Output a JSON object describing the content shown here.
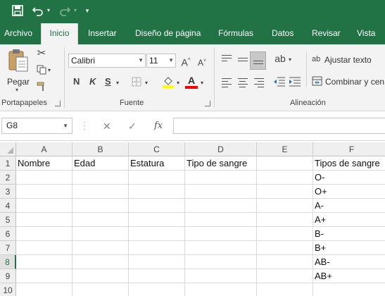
{
  "qat": {
    "save_icon": "save-icon",
    "undo_icon": "undo-icon",
    "redo_icon": "redo-icon",
    "customize_icon": "customize-qat-icon"
  },
  "tabs": [
    "Archivo",
    "Inicio",
    "Insertar",
    "Diseño de página",
    "Fórmulas",
    "Datos",
    "Revisar",
    "Vista"
  ],
  "active_tab": "Inicio",
  "ribbon": {
    "clipboard": {
      "paste_label": "Pegar",
      "group_label": "Portapapeles"
    },
    "font": {
      "font_name": "Calibri",
      "font_size": "11",
      "bold": "N",
      "italic": "K",
      "underline": "S",
      "group_label": "Fuente",
      "highlight_color": "#ffff00",
      "font_color": "#ff0000"
    },
    "alignment": {
      "wrap_label": "Ajustar texto",
      "merge_label": "Combinar y cen",
      "group_label": "Alineación"
    }
  },
  "formula_bar": {
    "name_box": "G8",
    "fx": "fx",
    "formula": ""
  },
  "sheet": {
    "columns": [
      "A",
      "B",
      "C",
      "D",
      "E",
      "F"
    ],
    "rows": [
      "1",
      "2",
      "3",
      "4",
      "5",
      "6",
      "7",
      "8",
      "9",
      "10"
    ],
    "selected_row": "8",
    "cells": [
      [
        "Nombre",
        "Edad",
        "Estatura",
        "Tipo de sangre",
        "",
        "Tipos de sangre"
      ],
      [
        "",
        "",
        "",
        "",
        "",
        "O-"
      ],
      [
        "",
        "",
        "",
        "",
        "",
        "O+"
      ],
      [
        "",
        "",
        "",
        "",
        "",
        "A-"
      ],
      [
        "",
        "",
        "",
        "",
        "",
        "A+"
      ],
      [
        "",
        "",
        "",
        "",
        "",
        "B-"
      ],
      [
        "",
        "",
        "",
        "",
        "",
        "B+"
      ],
      [
        "",
        "",
        "",
        "",
        "",
        "AB-"
      ],
      [
        "",
        "",
        "",
        "",
        "",
        "AB+"
      ],
      [
        "",
        "",
        "",
        "",
        "",
        ""
      ]
    ]
  },
  "colors": {
    "accent": "#217346"
  }
}
